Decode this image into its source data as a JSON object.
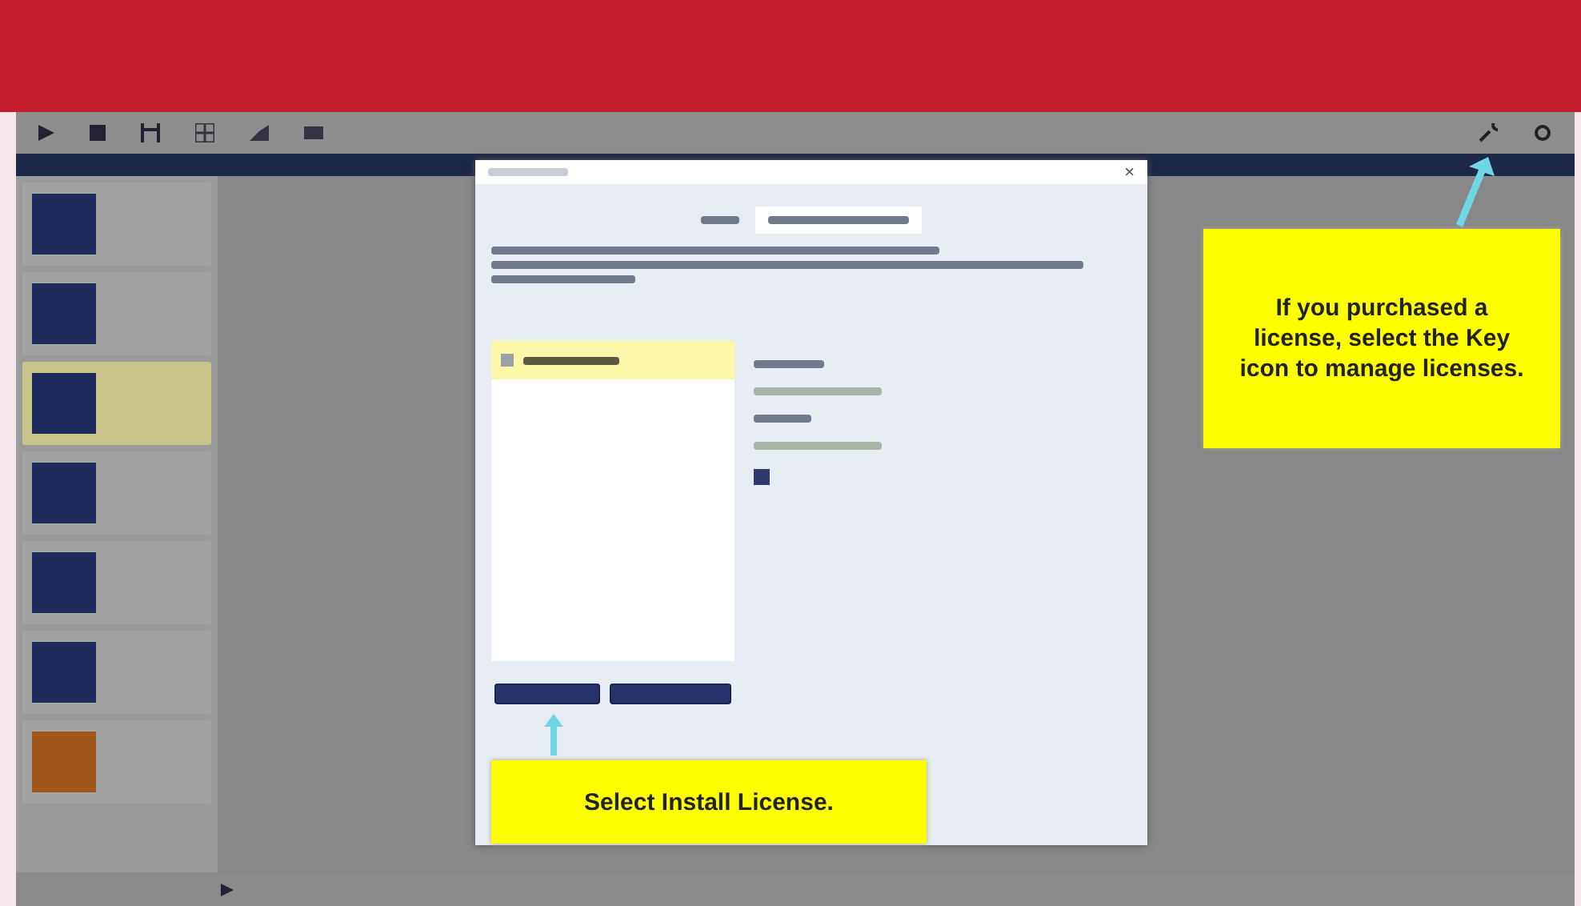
{
  "sidebar": {
    "items": [
      {
        "selected": false,
        "color": "#1f2a5c"
      },
      {
        "selected": false,
        "color": "#1f2a5c"
      },
      {
        "selected": true,
        "color": "#1f2a5c"
      },
      {
        "selected": false,
        "color": "#1f2a5c"
      },
      {
        "selected": false,
        "color": "#1f2a5c"
      },
      {
        "selected": false,
        "color": "#1f2a5c"
      },
      {
        "selected": false,
        "color": "#a0561a"
      }
    ]
  },
  "dialog": {
    "close": "×",
    "license_list": [
      {
        "selected": true,
        "checked": false
      }
    ],
    "option_checked": true
  },
  "callouts": [
    {
      "text": "If you purchased a license, select the Key icon to manage licenses."
    },
    {
      "text": "Select Install License."
    }
  ]
}
